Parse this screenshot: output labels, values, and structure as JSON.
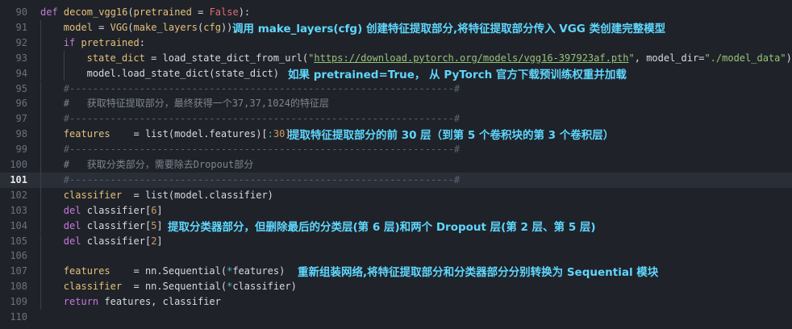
{
  "lines": [
    {
      "num": "90",
      "indent": 0,
      "tokens": [
        {
          "c": "kw",
          "t": "def "
        },
        {
          "c": "fn",
          "t": "decom_vgg16"
        },
        {
          "c": "tx",
          "t": "("
        },
        {
          "c": "pm",
          "t": "pretrained"
        },
        {
          "c": "tx",
          "t": " = "
        },
        {
          "c": "ct",
          "t": "False"
        },
        {
          "c": "tx",
          "t": "):"
        }
      ]
    },
    {
      "num": "91",
      "indent": 1,
      "tokens": [
        {
          "c": "pm",
          "t": "model"
        },
        {
          "c": "tx",
          "t": " = "
        },
        {
          "c": "fn",
          "t": "VGG"
        },
        {
          "c": "tx",
          "t": "("
        },
        {
          "c": "fn",
          "t": "make_layers"
        },
        {
          "c": "tx",
          "t": "("
        },
        {
          "c": "pm",
          "t": "cfg"
        },
        {
          "c": "tx",
          "t": "))"
        }
      ]
    },
    {
      "num": "92",
      "indent": 1,
      "tokens": [
        {
          "c": "kw",
          "t": "if "
        },
        {
          "c": "pm",
          "t": "pretrained"
        },
        {
          "c": "tx",
          "t": ":"
        }
      ]
    },
    {
      "num": "93",
      "indent": 2,
      "tokens": [
        {
          "c": "pm",
          "t": "state_dict"
        },
        {
          "c": "tx",
          "t": " = load_state_dict_from_url("
        },
        {
          "c": "st",
          "t": "\""
        },
        {
          "c": "ul",
          "t": "https://download.pytorch.org/models/vgg16-397923af.pth"
        },
        {
          "c": "st",
          "t": "\""
        },
        {
          "c": "tx",
          "t": ", model_dir="
        },
        {
          "c": "st",
          "t": "\"./model_data\""
        },
        {
          "c": "tx",
          "t": ")"
        }
      ]
    },
    {
      "num": "94",
      "indent": 2,
      "tokens": [
        {
          "c": "tx",
          "t": "model.load_state_dict(state_dict)"
        }
      ]
    },
    {
      "num": "95",
      "indent": 1,
      "tokens": [
        {
          "c": "cm",
          "t": "#------------------------------------------------------------------#"
        }
      ]
    },
    {
      "num": "96",
      "indent": 1,
      "tokens": [
        {
          "c": "cmz",
          "t": "#   获取特征提取部分，最终获得一个37,37,1024的特征层"
        }
      ]
    },
    {
      "num": "97",
      "indent": 1,
      "tokens": [
        {
          "c": "cm",
          "t": "#------------------------------------------------------------------#"
        }
      ]
    },
    {
      "num": "98",
      "indent": 1,
      "tokens": [
        {
          "c": "pm",
          "t": "features"
        },
        {
          "c": "tx",
          "t": "    = list(model.features)["
        },
        {
          "c": "op",
          "t": ":"
        },
        {
          "c": "nm",
          "t": "30"
        },
        {
          "c": "tx",
          "t": "]"
        }
      ]
    },
    {
      "num": "99",
      "indent": 1,
      "tokens": [
        {
          "c": "cm",
          "t": "#------------------------------------------------------------------#"
        }
      ]
    },
    {
      "num": "100",
      "indent": 1,
      "tokens": [
        {
          "c": "cmz",
          "t": "#   获取分类部分，需要除去Dropout部分"
        }
      ]
    },
    {
      "num": "101",
      "indent": 1,
      "current": true,
      "tokens": [
        {
          "c": "cm",
          "t": "#------------------------------------------------------------------#"
        }
      ]
    },
    {
      "num": "102",
      "indent": 1,
      "tokens": [
        {
          "c": "pm",
          "t": "classifier"
        },
        {
          "c": "tx",
          "t": "  = list(model.classifier)"
        }
      ]
    },
    {
      "num": "103",
      "indent": 1,
      "tokens": [
        {
          "c": "kw",
          "t": "del "
        },
        {
          "c": "tx",
          "t": "classifier["
        },
        {
          "c": "nm",
          "t": "6"
        },
        {
          "c": "tx",
          "t": "]"
        }
      ]
    },
    {
      "num": "104",
      "indent": 1,
      "tokens": [
        {
          "c": "kw",
          "t": "del "
        },
        {
          "c": "tx",
          "t": "classifier["
        },
        {
          "c": "nm",
          "t": "5"
        },
        {
          "c": "tx",
          "t": "]"
        }
      ]
    },
    {
      "num": "105",
      "indent": 1,
      "tokens": [
        {
          "c": "kw",
          "t": "del "
        },
        {
          "c": "tx",
          "t": "classifier["
        },
        {
          "c": "nm",
          "t": "2"
        },
        {
          "c": "tx",
          "t": "]"
        }
      ]
    },
    {
      "num": "106",
      "indent": 1,
      "tokens": []
    },
    {
      "num": "107",
      "indent": 1,
      "tokens": [
        {
          "c": "pm",
          "t": "features"
        },
        {
          "c": "tx",
          "t": "    = nn.Sequential("
        },
        {
          "c": "op",
          "t": "*"
        },
        {
          "c": "tx",
          "t": "features)"
        }
      ]
    },
    {
      "num": "108",
      "indent": 1,
      "tokens": [
        {
          "c": "pm",
          "t": "classifier"
        },
        {
          "c": "tx",
          "t": "  = nn.Sequential("
        },
        {
          "c": "op",
          "t": "*"
        },
        {
          "c": "tx",
          "t": "classifier)"
        }
      ]
    },
    {
      "num": "109",
      "indent": 1,
      "tokens": [
        {
          "c": "kw",
          "t": "return "
        },
        {
          "c": "tx",
          "t": "features, classifier"
        }
      ]
    },
    {
      "num": "110",
      "indent": 0,
      "tokens": []
    }
  ],
  "annotations": [
    {
      "line": 1,
      "text": "调用 make_layers(cfg) 创建特征提取部分,将特征提取部分传入 VGG 类创建完整模型"
    },
    {
      "line": 4,
      "text": "如果 pretrained=True， 从 PyTorch 官方下载预训练权重并加载"
    },
    {
      "line": 8,
      "text": "提取特征提取部分的前 30 层（到第 5 个卷积块的第 3 个卷积层）"
    },
    {
      "line": 14,
      "text": "提取分类器部分，但删除最后的分类层(第 6 层)和两个 Dropout 层(第 2 层、第 5 层)"
    },
    {
      "line": 17,
      "text": "重新组装网络,将特征提取部分和分类器部分分别转换为 Sequential 模块"
    }
  ]
}
